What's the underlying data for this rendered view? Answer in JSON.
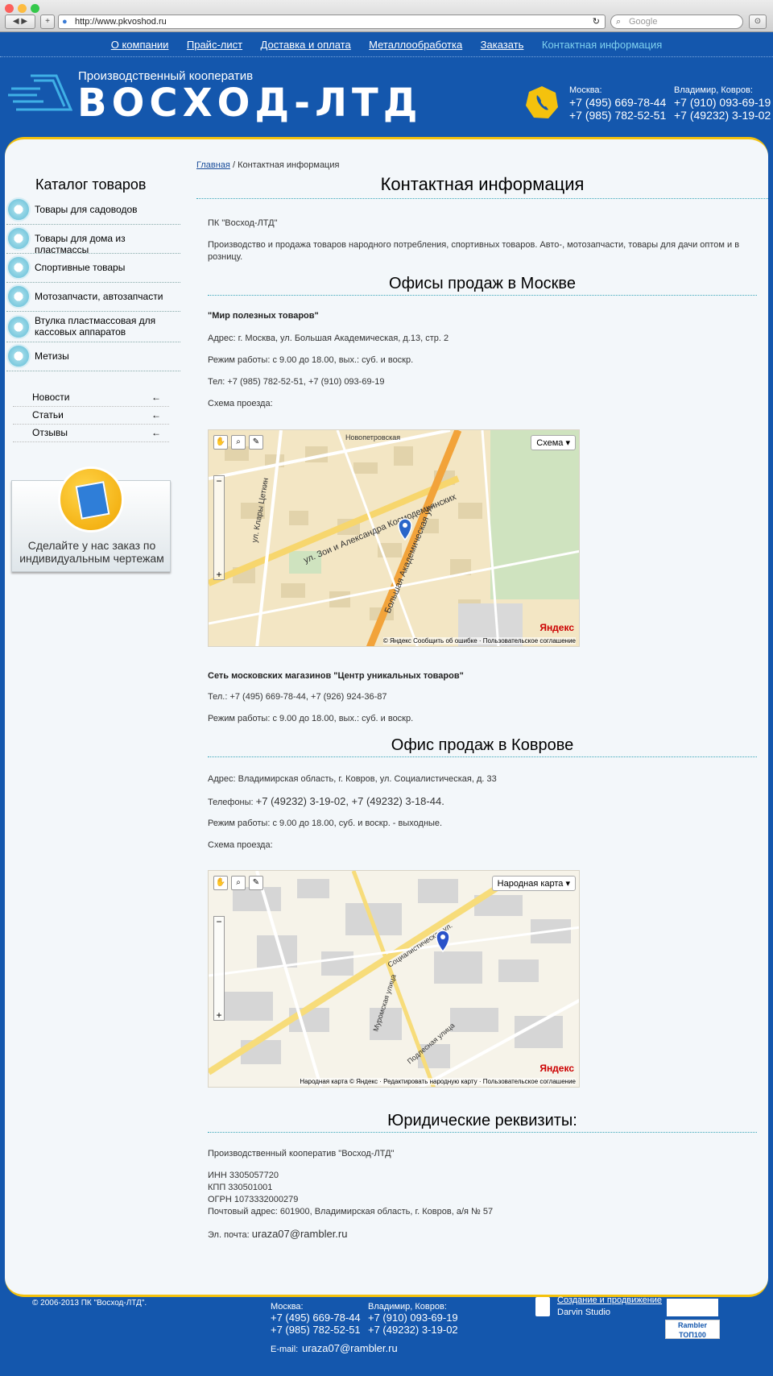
{
  "browser": {
    "url": "http://www.pkvoshod.ru",
    "search_placeholder": "Google"
  },
  "nav": [
    {
      "label": "О компании"
    },
    {
      "label": "Прайс-лист"
    },
    {
      "label": "Доставка и оплата"
    },
    {
      "label": "Металлообработка"
    },
    {
      "label": "Заказать"
    },
    {
      "label": "Контактная информация",
      "active": true
    }
  ],
  "header": {
    "subtitle": "Производственный кооператив",
    "title": "ВОСХОД-ЛТД",
    "moscow_label": "Москва:",
    "moscow_phones": [
      "+7 (495) 669-78-44",
      "+7 (985) 782-52-51"
    ],
    "vladimir_label": "Владимир, Ковров:",
    "vladimir_phones": [
      "+7 (910) 093-69-19",
      "+7 (49232) 3-19-02"
    ]
  },
  "sidebar": {
    "catalog_title": "Каталог товаров",
    "catalog": [
      {
        "label": "Товары для садоводов"
      },
      {
        "label": "Товары для дома из пластмассы"
      },
      {
        "label": "Спортивные товары"
      },
      {
        "label": "Мотозапчасти, автозапчасти"
      },
      {
        "label": "Втулка пластмассовая для кассовых аппаратов"
      },
      {
        "label": "Метизы"
      }
    ],
    "links": [
      {
        "label": "Новости",
        "arrow": "←"
      },
      {
        "label": "Статьи",
        "arrow": "←"
      },
      {
        "label": "Отзывы",
        "arrow": "←"
      }
    ],
    "promo": "Сделайте у нас заказ по индивидуальным чертежам"
  },
  "breadcrumb": {
    "home": "Главная",
    "sep": "/",
    "current": "Контактная информация"
  },
  "page_title": "Контактная информация",
  "intro": {
    "company": "ПК \"Восход-ЛТД\"",
    "description": "Производство и продажа товаров народного потребления, спортивных товаров. Авто-, мотозапчасти, товары для дачи оптом и в розницу."
  },
  "moscow": {
    "heading": "Офисы продаж в Москве",
    "shop_name": "\"Мир полезных товаров\"",
    "address": "Адрес: г. Москва, ул. Большая Академическая, д.13, стр. 2",
    "hours": "Режим работы: с 9.00 до 18.00, вых.: суб. и воскр.",
    "phones": "Тел: +7 (985) 782-52-51, +7 (910) 093-69-19",
    "scheme": "Схема проезда:",
    "map_type": "Схема ▾",
    "map_logo": "Яндекс",
    "map_copy": "© Яндекс  Сообщить об ошибке · Пользовательское соглашение",
    "streets": [
      "ул. Зои и Александра Космодемьянских",
      "Большая Академическая ул.",
      "ул. Клары Цеткин",
      "Новопетровская"
    ],
    "network_name": "Сеть московских магазинов \"Центр уникальных товаров\"",
    "network_phones": "Тел.: +7 (495) 669-78-44,  +7 (926) 924-36-87",
    "network_hours": "Режим работы: с 9.00 до 18.00, вых.: суб. и воскр."
  },
  "kovrov": {
    "heading": "Офис продаж в Коврове",
    "address": "Адрес: Владимирская область, г. Ковров, ул. Социалистическая, д. 33",
    "phones_label": "Телефоны: ",
    "phones": "+7 (49232) 3-19-02, +7 (49232) 3-18-44.",
    "hours": "Режим работы: с 9.00 до 18.00, суб. и воскр. - выходные.",
    "scheme": "Схема проезда:",
    "map_type": "Народная карта ▾",
    "map_logo": "Яндекс",
    "map_copy": "Народная карта © Яндекс · Редактировать народную карту · Пользовательское соглашение",
    "streets": [
      "Социалистическая ул.",
      "Муромская улица",
      "Подлесная улица"
    ]
  },
  "legal": {
    "heading": "Юридические реквизиты:",
    "company": "Производственный кооператив \"Восход-ЛТД\"",
    "inn": "ИНН 3305057720",
    "kpp": "КПП 330501001",
    "ogrn": "ОГРН 1073332000279",
    "postal": "Почтовый адрес: 601900, Владимирская область, г. Ковров, а/я № 57",
    "email_label": "Эл. почта: ",
    "email": "uraza07@rambler.ru"
  },
  "footer": {
    "copyright": "© 2006-2013 ПК \"Восход-ЛТД\".",
    "moscow_label": "Москва:",
    "moscow_phones": [
      "+7 (495) 669-78-44",
      "+7 (985) 782-52-51"
    ],
    "vladimir_label": "Владимир, Ковров:",
    "vladimir_phones": [
      "+7 (910) 093-69-19",
      "+7 (49232) 3-19-02"
    ],
    "email_label": "E-mail:",
    "email": "uraza07@rambler.ru",
    "dev_link": "Создание и продвижение",
    "dev_name": "Darvin Studio",
    "rambler": "Rambler ТОП100"
  }
}
